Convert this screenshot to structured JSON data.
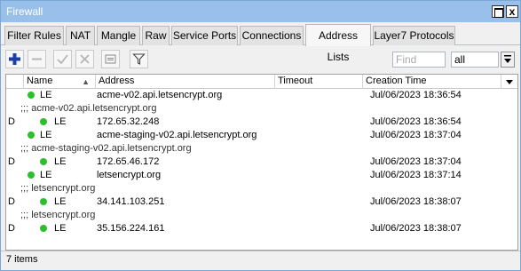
{
  "window": {
    "title": "Firewall",
    "close_label": "x"
  },
  "tabs": [
    {
      "label": "Filter Rules",
      "active": false
    },
    {
      "label": "NAT",
      "active": false
    },
    {
      "label": "Mangle",
      "active": false
    },
    {
      "label": "Raw",
      "active": false
    },
    {
      "label": "Service Ports",
      "active": false
    },
    {
      "label": "Connections",
      "active": false
    },
    {
      "label": "Address Lists",
      "active": true
    },
    {
      "label": "Layer7 Protocols",
      "active": false
    }
  ],
  "toolbar": {
    "icons": [
      "add-icon",
      "remove-icon",
      "enable-icon",
      "disable-icon",
      "comment-icon",
      "filter-icon"
    ],
    "find_placeholder": "Find",
    "filter_select_value": "all"
  },
  "table": {
    "columns": [
      "Name",
      "Address",
      "Timeout",
      "Creation Time"
    ],
    "rows": [
      {
        "kind": "entry",
        "flag": "",
        "name": "LE",
        "address": "acme-v02.api.letsencrypt.org",
        "timeout": "",
        "creation_time": "Jul/06/2023 18:36:54"
      },
      {
        "kind": "comment",
        "text": ";;; acme-v02.api.letsencrypt.org"
      },
      {
        "kind": "entry",
        "flag": "D",
        "name": "LE",
        "address": "172.65.32.248",
        "timeout": "",
        "creation_time": "Jul/06/2023 18:36:54"
      },
      {
        "kind": "entry",
        "flag": "",
        "name": "LE",
        "address": "acme-staging-v02.api.letsencrypt.org",
        "timeout": "",
        "creation_time": "Jul/06/2023 18:37:04"
      },
      {
        "kind": "comment",
        "text": ";;; acme-staging-v02.api.letsencrypt.org"
      },
      {
        "kind": "entry",
        "flag": "D",
        "name": "LE",
        "address": "172.65.46.172",
        "timeout": "",
        "creation_time": "Jul/06/2023 18:37:04"
      },
      {
        "kind": "entry",
        "flag": "",
        "name": "LE",
        "address": "letsencrypt.org",
        "timeout": "",
        "creation_time": "Jul/06/2023 18:37:14"
      },
      {
        "kind": "comment",
        "text": ";;; letsencrypt.org"
      },
      {
        "kind": "entry",
        "flag": "D",
        "name": "LE",
        "address": "34.141.103.251",
        "timeout": "",
        "creation_time": "Jul/06/2023 18:38:07"
      },
      {
        "kind": "comment",
        "text": ";;; letsencrypt.org"
      },
      {
        "kind": "entry",
        "flag": "D",
        "name": "LE",
        "address": "35.156.224.161",
        "timeout": "",
        "creation_time": "Jul/06/2023 18:38:07"
      }
    ]
  },
  "status": {
    "text": "7 items"
  },
  "colors": {
    "titlebar": "#99c0ea",
    "enabled_dot": "#2bbf2b",
    "add_icon": "#1b3fa6"
  }
}
